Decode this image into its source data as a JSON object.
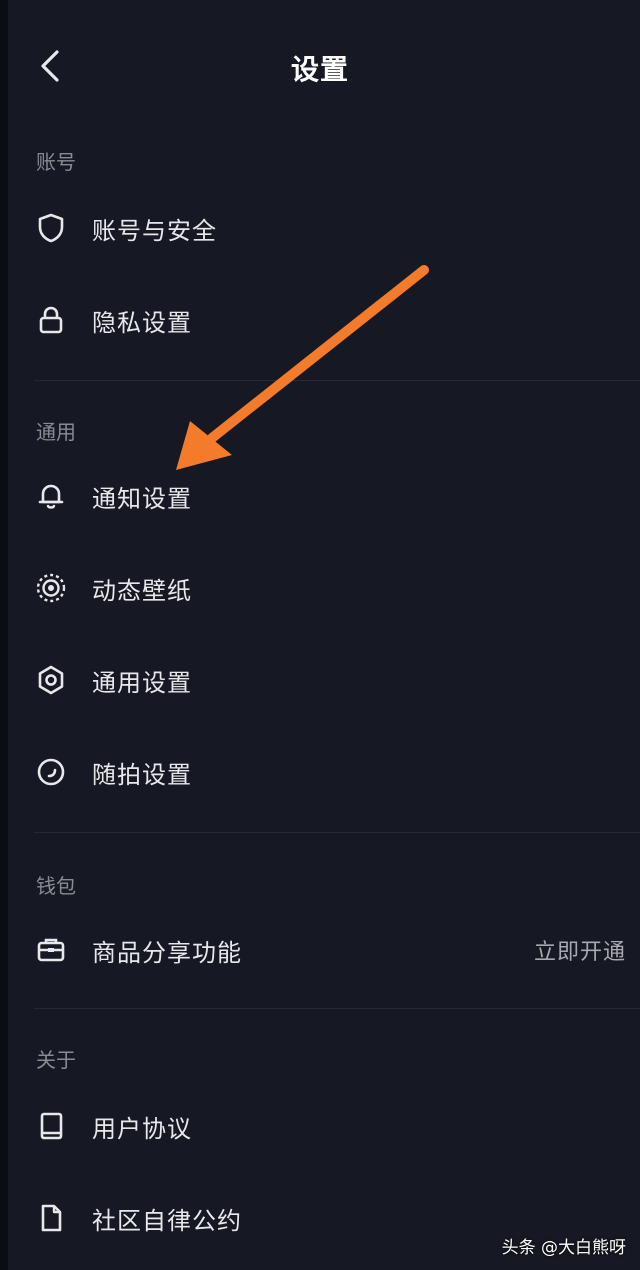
{
  "header": {
    "title": "设置",
    "back_icon": "chevron-left-icon"
  },
  "sections": {
    "account": {
      "label": "账号",
      "items": [
        {
          "label": "账号与安全",
          "icon": "shield-icon"
        },
        {
          "label": "隐私设置",
          "icon": "lock-icon"
        }
      ]
    },
    "general": {
      "label": "通用",
      "items": [
        {
          "label": "通知设置",
          "icon": "bell-icon"
        },
        {
          "label": "动态壁纸",
          "icon": "live-wallpaper-icon"
        },
        {
          "label": "通用设置",
          "icon": "gear-icon"
        },
        {
          "label": "随拍设置",
          "icon": "snapshot-icon"
        }
      ]
    },
    "wallet": {
      "label": "钱包",
      "items": [
        {
          "label": "商品分享功能",
          "icon": "briefcase-icon",
          "action": "立即开通"
        }
      ]
    },
    "about": {
      "label": "关于",
      "items": [
        {
          "label": "用户协议",
          "icon": "book-icon"
        },
        {
          "label": "社区自律公约",
          "icon": "document-icon"
        }
      ]
    }
  },
  "annotation": {
    "arrow_color": "#f47b2a"
  },
  "watermark": {
    "text": "头条 @大白熊呀"
  },
  "colors": {
    "background": "#161823",
    "text": "#e8e8ea",
    "section_label": "#8a8b91"
  }
}
